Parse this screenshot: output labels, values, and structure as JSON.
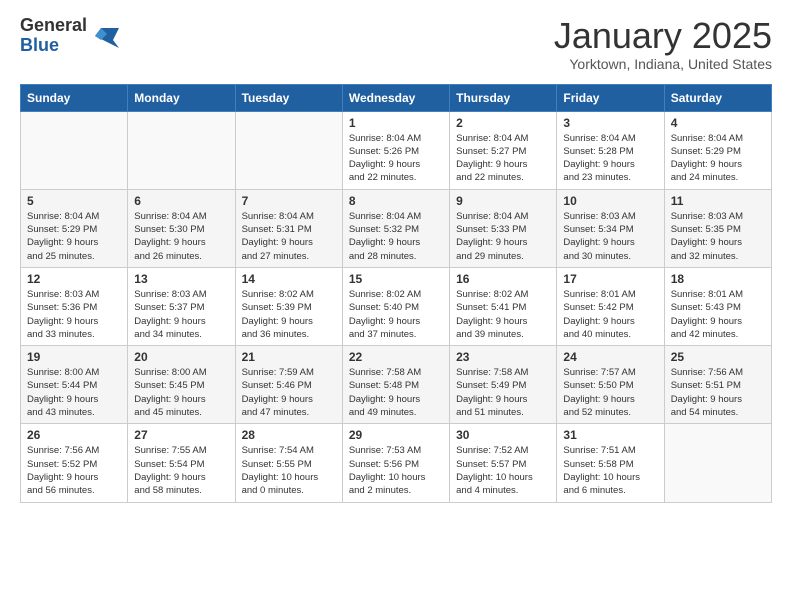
{
  "header": {
    "logo_line1": "General",
    "logo_line2": "Blue",
    "month": "January 2025",
    "location": "Yorktown, Indiana, United States"
  },
  "days_of_week": [
    "Sunday",
    "Monday",
    "Tuesday",
    "Wednesday",
    "Thursday",
    "Friday",
    "Saturday"
  ],
  "weeks": [
    [
      {
        "day": "",
        "info": ""
      },
      {
        "day": "",
        "info": ""
      },
      {
        "day": "",
        "info": ""
      },
      {
        "day": "1",
        "info": "Sunrise: 8:04 AM\nSunset: 5:26 PM\nDaylight: 9 hours\nand 22 minutes."
      },
      {
        "day": "2",
        "info": "Sunrise: 8:04 AM\nSunset: 5:27 PM\nDaylight: 9 hours\nand 22 minutes."
      },
      {
        "day": "3",
        "info": "Sunrise: 8:04 AM\nSunset: 5:28 PM\nDaylight: 9 hours\nand 23 minutes."
      },
      {
        "day": "4",
        "info": "Sunrise: 8:04 AM\nSunset: 5:29 PM\nDaylight: 9 hours\nand 24 minutes."
      }
    ],
    [
      {
        "day": "5",
        "info": "Sunrise: 8:04 AM\nSunset: 5:29 PM\nDaylight: 9 hours\nand 25 minutes."
      },
      {
        "day": "6",
        "info": "Sunrise: 8:04 AM\nSunset: 5:30 PM\nDaylight: 9 hours\nand 26 minutes."
      },
      {
        "day": "7",
        "info": "Sunrise: 8:04 AM\nSunset: 5:31 PM\nDaylight: 9 hours\nand 27 minutes."
      },
      {
        "day": "8",
        "info": "Sunrise: 8:04 AM\nSunset: 5:32 PM\nDaylight: 9 hours\nand 28 minutes."
      },
      {
        "day": "9",
        "info": "Sunrise: 8:04 AM\nSunset: 5:33 PM\nDaylight: 9 hours\nand 29 minutes."
      },
      {
        "day": "10",
        "info": "Sunrise: 8:03 AM\nSunset: 5:34 PM\nDaylight: 9 hours\nand 30 minutes."
      },
      {
        "day": "11",
        "info": "Sunrise: 8:03 AM\nSunset: 5:35 PM\nDaylight: 9 hours\nand 32 minutes."
      }
    ],
    [
      {
        "day": "12",
        "info": "Sunrise: 8:03 AM\nSunset: 5:36 PM\nDaylight: 9 hours\nand 33 minutes."
      },
      {
        "day": "13",
        "info": "Sunrise: 8:03 AM\nSunset: 5:37 PM\nDaylight: 9 hours\nand 34 minutes."
      },
      {
        "day": "14",
        "info": "Sunrise: 8:02 AM\nSunset: 5:39 PM\nDaylight: 9 hours\nand 36 minutes."
      },
      {
        "day": "15",
        "info": "Sunrise: 8:02 AM\nSunset: 5:40 PM\nDaylight: 9 hours\nand 37 minutes."
      },
      {
        "day": "16",
        "info": "Sunrise: 8:02 AM\nSunset: 5:41 PM\nDaylight: 9 hours\nand 39 minutes."
      },
      {
        "day": "17",
        "info": "Sunrise: 8:01 AM\nSunset: 5:42 PM\nDaylight: 9 hours\nand 40 minutes."
      },
      {
        "day": "18",
        "info": "Sunrise: 8:01 AM\nSunset: 5:43 PM\nDaylight: 9 hours\nand 42 minutes."
      }
    ],
    [
      {
        "day": "19",
        "info": "Sunrise: 8:00 AM\nSunset: 5:44 PM\nDaylight: 9 hours\nand 43 minutes."
      },
      {
        "day": "20",
        "info": "Sunrise: 8:00 AM\nSunset: 5:45 PM\nDaylight: 9 hours\nand 45 minutes."
      },
      {
        "day": "21",
        "info": "Sunrise: 7:59 AM\nSunset: 5:46 PM\nDaylight: 9 hours\nand 47 minutes."
      },
      {
        "day": "22",
        "info": "Sunrise: 7:58 AM\nSunset: 5:48 PM\nDaylight: 9 hours\nand 49 minutes."
      },
      {
        "day": "23",
        "info": "Sunrise: 7:58 AM\nSunset: 5:49 PM\nDaylight: 9 hours\nand 51 minutes."
      },
      {
        "day": "24",
        "info": "Sunrise: 7:57 AM\nSunset: 5:50 PM\nDaylight: 9 hours\nand 52 minutes."
      },
      {
        "day": "25",
        "info": "Sunrise: 7:56 AM\nSunset: 5:51 PM\nDaylight: 9 hours\nand 54 minutes."
      }
    ],
    [
      {
        "day": "26",
        "info": "Sunrise: 7:56 AM\nSunset: 5:52 PM\nDaylight: 9 hours\nand 56 minutes."
      },
      {
        "day": "27",
        "info": "Sunrise: 7:55 AM\nSunset: 5:54 PM\nDaylight: 9 hours\nand 58 minutes."
      },
      {
        "day": "28",
        "info": "Sunrise: 7:54 AM\nSunset: 5:55 PM\nDaylight: 10 hours\nand 0 minutes."
      },
      {
        "day": "29",
        "info": "Sunrise: 7:53 AM\nSunset: 5:56 PM\nDaylight: 10 hours\nand 2 minutes."
      },
      {
        "day": "30",
        "info": "Sunrise: 7:52 AM\nSunset: 5:57 PM\nDaylight: 10 hours\nand 4 minutes."
      },
      {
        "day": "31",
        "info": "Sunrise: 7:51 AM\nSunset: 5:58 PM\nDaylight: 10 hours\nand 6 minutes."
      },
      {
        "day": "",
        "info": ""
      }
    ]
  ]
}
